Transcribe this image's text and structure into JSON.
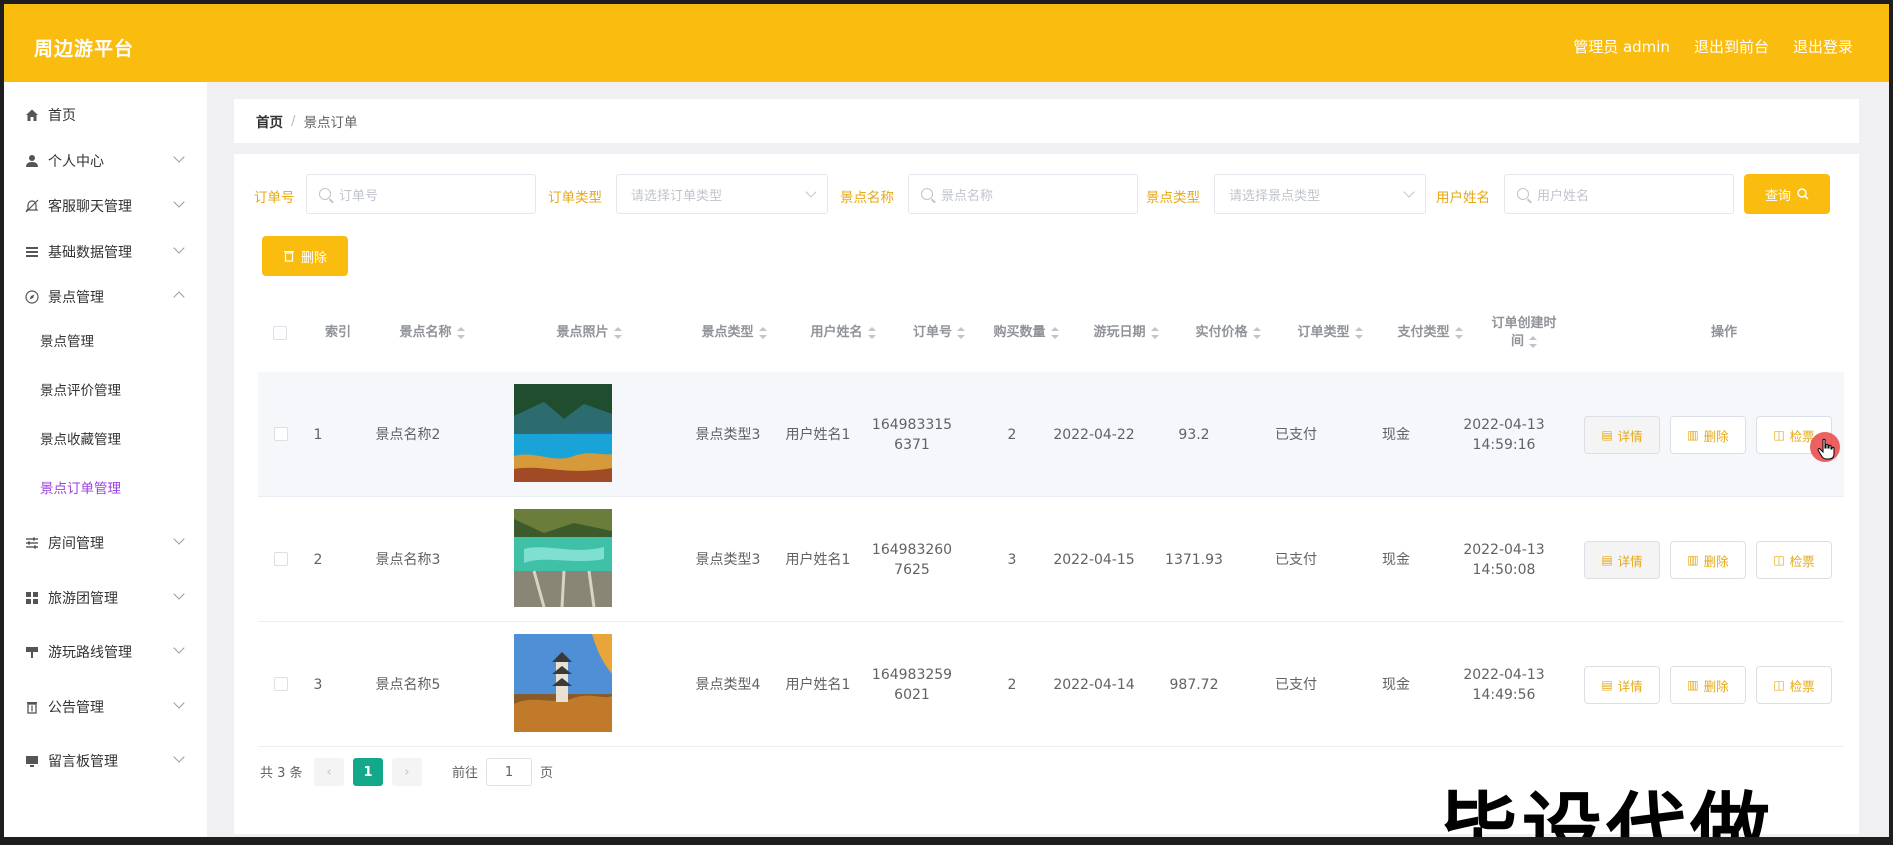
{
  "header": {
    "brand": "周边游平台",
    "admin_label": "管理员 admin",
    "exit_frontend": "退出到前台",
    "logout": "退出登录"
  },
  "sidebar": {
    "items": [
      {
        "label": "首页",
        "icon": "home-icon"
      },
      {
        "label": "个人中心",
        "icon": "user-icon"
      },
      {
        "label": "客服聊天管理",
        "icon": "bell-off-icon"
      },
      {
        "label": "基础数据管理",
        "icon": "list-icon"
      },
      {
        "label": "景点管理",
        "icon": "compass-icon"
      },
      {
        "label": "房间管理",
        "icon": "sliders-icon"
      },
      {
        "label": "旅游团管理",
        "icon": "grid-icon"
      },
      {
        "label": "游玩路线管理",
        "icon": "signpost-icon"
      },
      {
        "label": "公告管理",
        "icon": "trash-icon"
      },
      {
        "label": "留言板管理",
        "icon": "monitor-icon"
      }
    ],
    "sub_items": [
      "景点管理",
      "景点评价管理",
      "景点收藏管理",
      "景点订单管理"
    ]
  },
  "breadcrumb": {
    "home": "首页",
    "separator": "/",
    "current": "景点订单"
  },
  "filters": {
    "order_no_label": "订单号",
    "order_no_placeholder": "订单号",
    "order_type_label": "订单类型",
    "order_type_placeholder": "请选择订单类型",
    "spot_name_label": "景点名称",
    "spot_name_placeholder": "景点名称",
    "spot_type_label": "景点类型",
    "spot_type_placeholder": "请选择景点类型",
    "user_name_label": "用户姓名",
    "user_name_placeholder": "用户姓名",
    "query_button": "查询",
    "delete_button": "删除"
  },
  "table": {
    "headers": {
      "index": "索引",
      "spot_name": "景点名称",
      "spot_photo": "景点照片",
      "spot_type": "景点类型",
      "user_name": "用户姓名",
      "order_no": "订单号",
      "quantity": "购买数量",
      "play_date": "游玩日期",
      "price": "实付价格",
      "order_type": "订单类型",
      "pay_type": "支付类型",
      "created_1": "订单创建时",
      "created_2": "间",
      "actions": "操作"
    },
    "rows": [
      {
        "index": "1",
        "spot_name": "景点名称2",
        "spot_type": "景点类型3",
        "user_name": "用户姓名1",
        "order_no_1": "164983315",
        "order_no_2": "6371",
        "quantity": "2",
        "play_date": "2022-04-22",
        "price": "93.2",
        "order_type": "已支付",
        "pay_type": "现金",
        "created_date": "2022-04-13",
        "created_time": "14:59:16"
      },
      {
        "index": "2",
        "spot_name": "景点名称3",
        "spot_type": "景点类型3",
        "user_name": "用户姓名1",
        "order_no_1": "164983260",
        "order_no_2": "7625",
        "quantity": "3",
        "play_date": "2022-04-15",
        "price": "1371.93",
        "order_type": "已支付",
        "pay_type": "现金",
        "created_date": "2022-04-13",
        "created_time": "14:50:08"
      },
      {
        "index": "3",
        "spot_name": "景点名称5",
        "spot_type": "景点类型4",
        "user_name": "用户姓名1",
        "order_no_1": "164983259",
        "order_no_2": "6021",
        "quantity": "2",
        "play_date": "2022-04-14",
        "price": "987.72",
        "order_type": "已支付",
        "pay_type": "现金",
        "created_date": "2022-04-13",
        "created_time": "14:49:56"
      }
    ],
    "actions": {
      "detail": "详情",
      "delete": "删除",
      "ticket": "检票"
    }
  },
  "pagination": {
    "total": "共 3 条",
    "current_page": "1",
    "goto_label": "前往",
    "goto_value": "1",
    "page_suffix": "页"
  },
  "watermark": "毕设代做",
  "colors": {
    "accent": "#fbbc10",
    "active_menu": "#9b3fe0",
    "page_active": "#14a88a",
    "label": "#e6a817"
  }
}
